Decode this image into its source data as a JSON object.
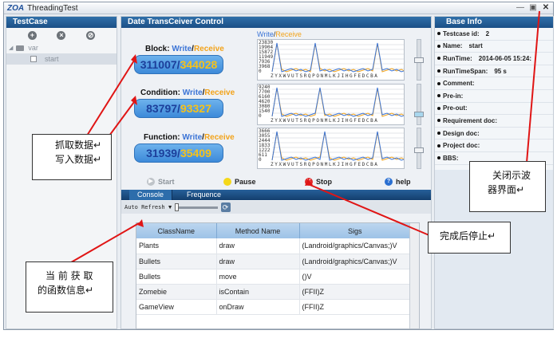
{
  "window": {
    "logo": "ZOA",
    "title": "ThreadingTest",
    "minimize": "—",
    "restore": "▣",
    "close": "✕"
  },
  "testcase": {
    "header": "TestCase",
    "toolbar": {
      "add": "+",
      "remove": "×",
      "edit": "⊘"
    },
    "tree": [
      {
        "label": "var"
      },
      {
        "label": "start"
      }
    ]
  },
  "dtc": {
    "header": "Date TransCeiver Control",
    "legend": {
      "write": "Write",
      "sep": "/",
      "receive": "Receive"
    },
    "stats": [
      {
        "name": "Block:",
        "write": "311007",
        "receive": "344028",
        "yticks": [
          "23830",
          "19904",
          "15872",
          "11949",
          "7936",
          "3968",
          "0"
        ]
      },
      {
        "name": "Condition:",
        "write": "83797",
        "receive": "93327",
        "yticks": [
          "9240",
          "7700",
          "6160",
          "4620",
          "3080",
          "1540",
          "0"
        ]
      },
      {
        "name": "Function:",
        "write": "31939",
        "receive": "35409",
        "yticks": [
          "3666",
          "3055",
          "2444",
          "1833",
          "1222",
          "611",
          "0"
        ]
      }
    ],
    "write_word": "Write",
    "sep": "/",
    "receive_word": "Receive",
    "xaxis": "ZYXWVUTSRQPONMLKJIHGFEDCBA",
    "controls": {
      "start": "Start",
      "pause": "Pause",
      "stop": "Stop",
      "help": "help"
    }
  },
  "console": {
    "tabs": [
      "Console",
      "Frequence"
    ],
    "auto_refresh": "Auto Refresh",
    "columns": [
      "ClassName",
      "Method Name",
      "Sigs"
    ],
    "rows": [
      [
        "Plants",
        "draw",
        "(Landroid/graphics/Canvas;)V"
      ],
      [
        "Bullets",
        "draw",
        "(Landroid/graphics/Canvas;)V"
      ],
      [
        "Bullets",
        "move",
        "()V"
      ],
      [
        "Zomebie",
        "isContain",
        "(FFII)Z"
      ],
      [
        "GameView",
        "onDraw",
        "(FFII)Z"
      ]
    ]
  },
  "base_info": {
    "header": "Base Info",
    "rows": [
      {
        "label": "Testcase id:",
        "value": "2"
      },
      {
        "label": "Name:",
        "value": "start"
      },
      {
        "label": "RunTime:",
        "value": "2014-06-05 15:24:"
      },
      {
        "label": "RunTimeSpan:",
        "value": "95 s"
      },
      {
        "label": "Comment:",
        "value": ""
      },
      {
        "label": "Pre-in:",
        "value": ""
      },
      {
        "label": "Pre-out:",
        "value": ""
      },
      {
        "label": "Requirement doc:",
        "value": ""
      },
      {
        "label": "Design doc:",
        "value": ""
      },
      {
        "label": "Project doc:",
        "value": ""
      },
      {
        "label": "BBS:",
        "value": ""
      }
    ]
  },
  "annotations": {
    "capture": [
      "抓取数据↵",
      "写入数据↵"
    ],
    "close": [
      "关闭示波",
      "器界面↵"
    ],
    "stop": "完成后停止↵",
    "func": [
      "当 前 获 取",
      "的函数信息↵"
    ]
  }
}
